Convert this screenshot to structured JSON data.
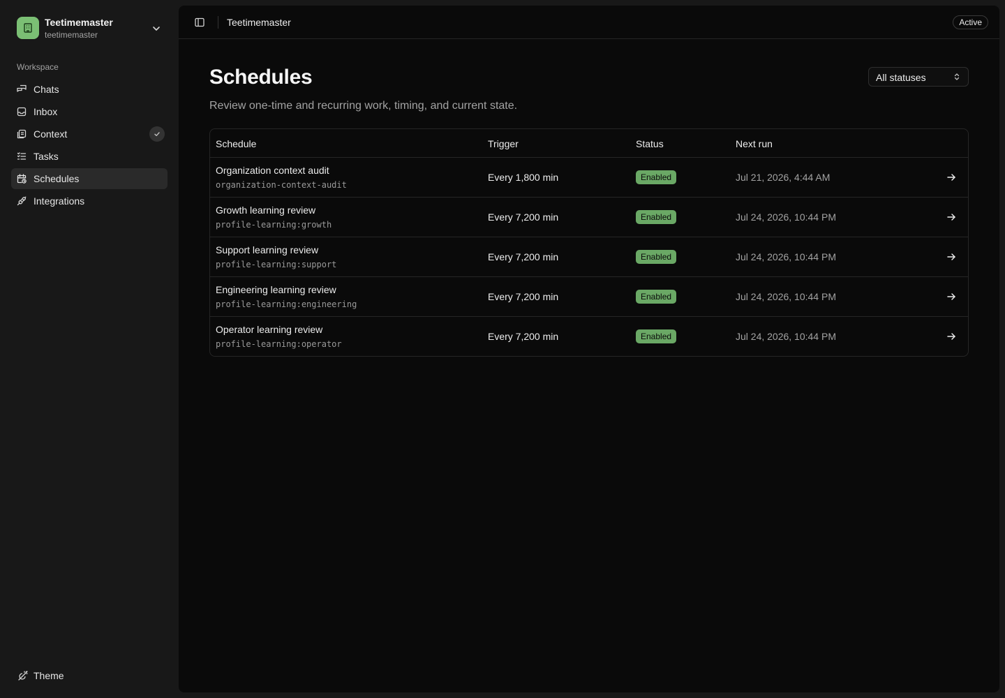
{
  "org": {
    "name": "Teetimemaster",
    "slug": "teetimemaster",
    "logo_icon": "building-icon",
    "logo_color": "#7bbf74"
  },
  "sidebar": {
    "section_label": "Workspace",
    "items": [
      {
        "label": "Chats",
        "icon": "chats-icon",
        "active": false
      },
      {
        "label": "Inbox",
        "icon": "inbox-icon",
        "active": false
      },
      {
        "label": "Context",
        "icon": "context-icon",
        "active": false,
        "badge": "check-icon"
      },
      {
        "label": "Tasks",
        "icon": "tasks-icon",
        "active": false
      },
      {
        "label": "Schedules",
        "icon": "calendar-clock-icon",
        "active": true
      },
      {
        "label": "Integrations",
        "icon": "plug-icon",
        "active": false
      }
    ],
    "theme_label": "Theme"
  },
  "topbar": {
    "breadcrumb": "Teetimemaster",
    "status": "Active"
  },
  "page": {
    "title": "Schedules",
    "subtitle": "Review one-time and recurring work, timing, and current state.",
    "filter_value": "All statuses"
  },
  "table": {
    "headers": {
      "schedule": "Schedule",
      "trigger": "Trigger",
      "status": "Status",
      "next_run": "Next run"
    },
    "rows": [
      {
        "name": "Organization context audit",
        "slug": "organization-context-audit",
        "trigger": "Every 1,800 min",
        "status": "Enabled",
        "next_run": "Jul 21, 2026, 4:44 AM"
      },
      {
        "name": "Growth learning review",
        "slug": "profile-learning:growth",
        "trigger": "Every 7,200 min",
        "status": "Enabled",
        "next_run": "Jul 24, 2026, 10:44 PM"
      },
      {
        "name": "Support learning review",
        "slug": "profile-learning:support",
        "trigger": "Every 7,200 min",
        "status": "Enabled",
        "next_run": "Jul 24, 2026, 10:44 PM"
      },
      {
        "name": "Engineering learning review",
        "slug": "profile-learning:engineering",
        "trigger": "Every 7,200 min",
        "status": "Enabled",
        "next_run": "Jul 24, 2026, 10:44 PM"
      },
      {
        "name": "Operator learning review",
        "slug": "profile-learning:operator",
        "trigger": "Every 7,200 min",
        "status": "Enabled",
        "next_run": "Jul 24, 2026, 10:44 PM"
      }
    ]
  },
  "colors": {
    "status_enabled": "#6aa865",
    "background": "#0a0a0a",
    "sidebar_bg": "#181818"
  }
}
